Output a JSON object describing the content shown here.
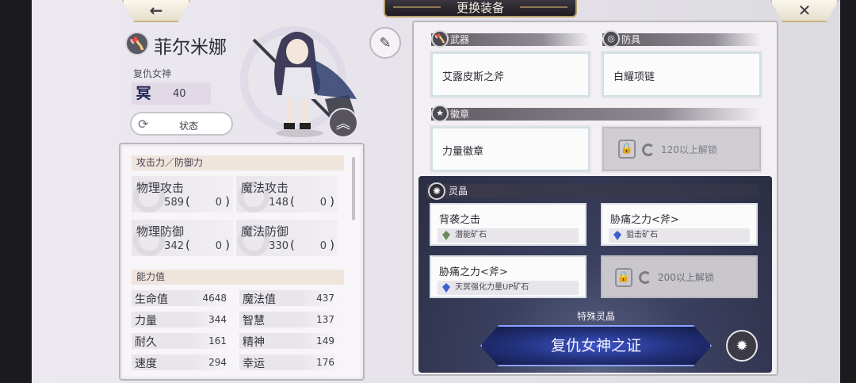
{
  "header": {
    "title": "更换装备",
    "back_icon": "←",
    "close_icon": "✕"
  },
  "character": {
    "name": "菲尔米娜",
    "title": "复仇女神",
    "rank_glyph": "冥",
    "level": "40",
    "status_button": "状态"
  },
  "stats": {
    "attack_defense_header": "攻击力／防御力",
    "cards": [
      {
        "name": "物理攻击",
        "value": "589",
        "paren_open": "(",
        "bonus": "0",
        "paren_close": ")"
      },
      {
        "name": "魔法攻击",
        "value": "148",
        "paren_open": "(",
        "bonus": "0",
        "paren_close": ")"
      },
      {
        "name": "物理防御",
        "value": "342",
        "paren_open": "(",
        "bonus": "0",
        "paren_close": ")"
      },
      {
        "name": "魔法防御",
        "value": "330",
        "paren_open": "(",
        "bonus": "0",
        "paren_close": ")"
      }
    ],
    "ability_header": "能力值",
    "abilities": [
      {
        "name": "生命值",
        "value": "4648"
      },
      {
        "name": "魔法值",
        "value": "437"
      },
      {
        "name": "力量",
        "value": "344"
      },
      {
        "name": "智慧",
        "value": "137"
      },
      {
        "name": "耐久",
        "value": "161"
      },
      {
        "name": "精神",
        "value": "149"
      },
      {
        "name": "速度",
        "value": "294"
      },
      {
        "name": "幸运",
        "value": "176"
      }
    ]
  },
  "equipment": {
    "weapon_label": "武器",
    "weapon_item": "艾露皮斯之斧",
    "armor_label": "防具",
    "armor_item": "白耀项链",
    "emblem_label": "徽章",
    "emblem_item": "力量徽章",
    "emblem_locked_text": "120以上解锁"
  },
  "crystals": {
    "label": "灵晶",
    "slots": [
      {
        "name": "背袭之击",
        "ore": "潜能矿石",
        "gem_color": "#6b8a5a"
      },
      {
        "name": "胁痛之力<斧>",
        "ore": "狙击矿石",
        "gem_color": "#3f5fd0"
      },
      {
        "name": "胁痛之力<斧>",
        "ore": "天冥强化力量UP矿石",
        "gem_color": "#3f5fd0"
      }
    ],
    "locked_text": "200以上解锁",
    "special_label": "特殊灵晶",
    "special_item": "复仇女神之证"
  },
  "colors": {
    "accent_gold": "#b89e6a",
    "special_blue": "#3d55c8"
  }
}
